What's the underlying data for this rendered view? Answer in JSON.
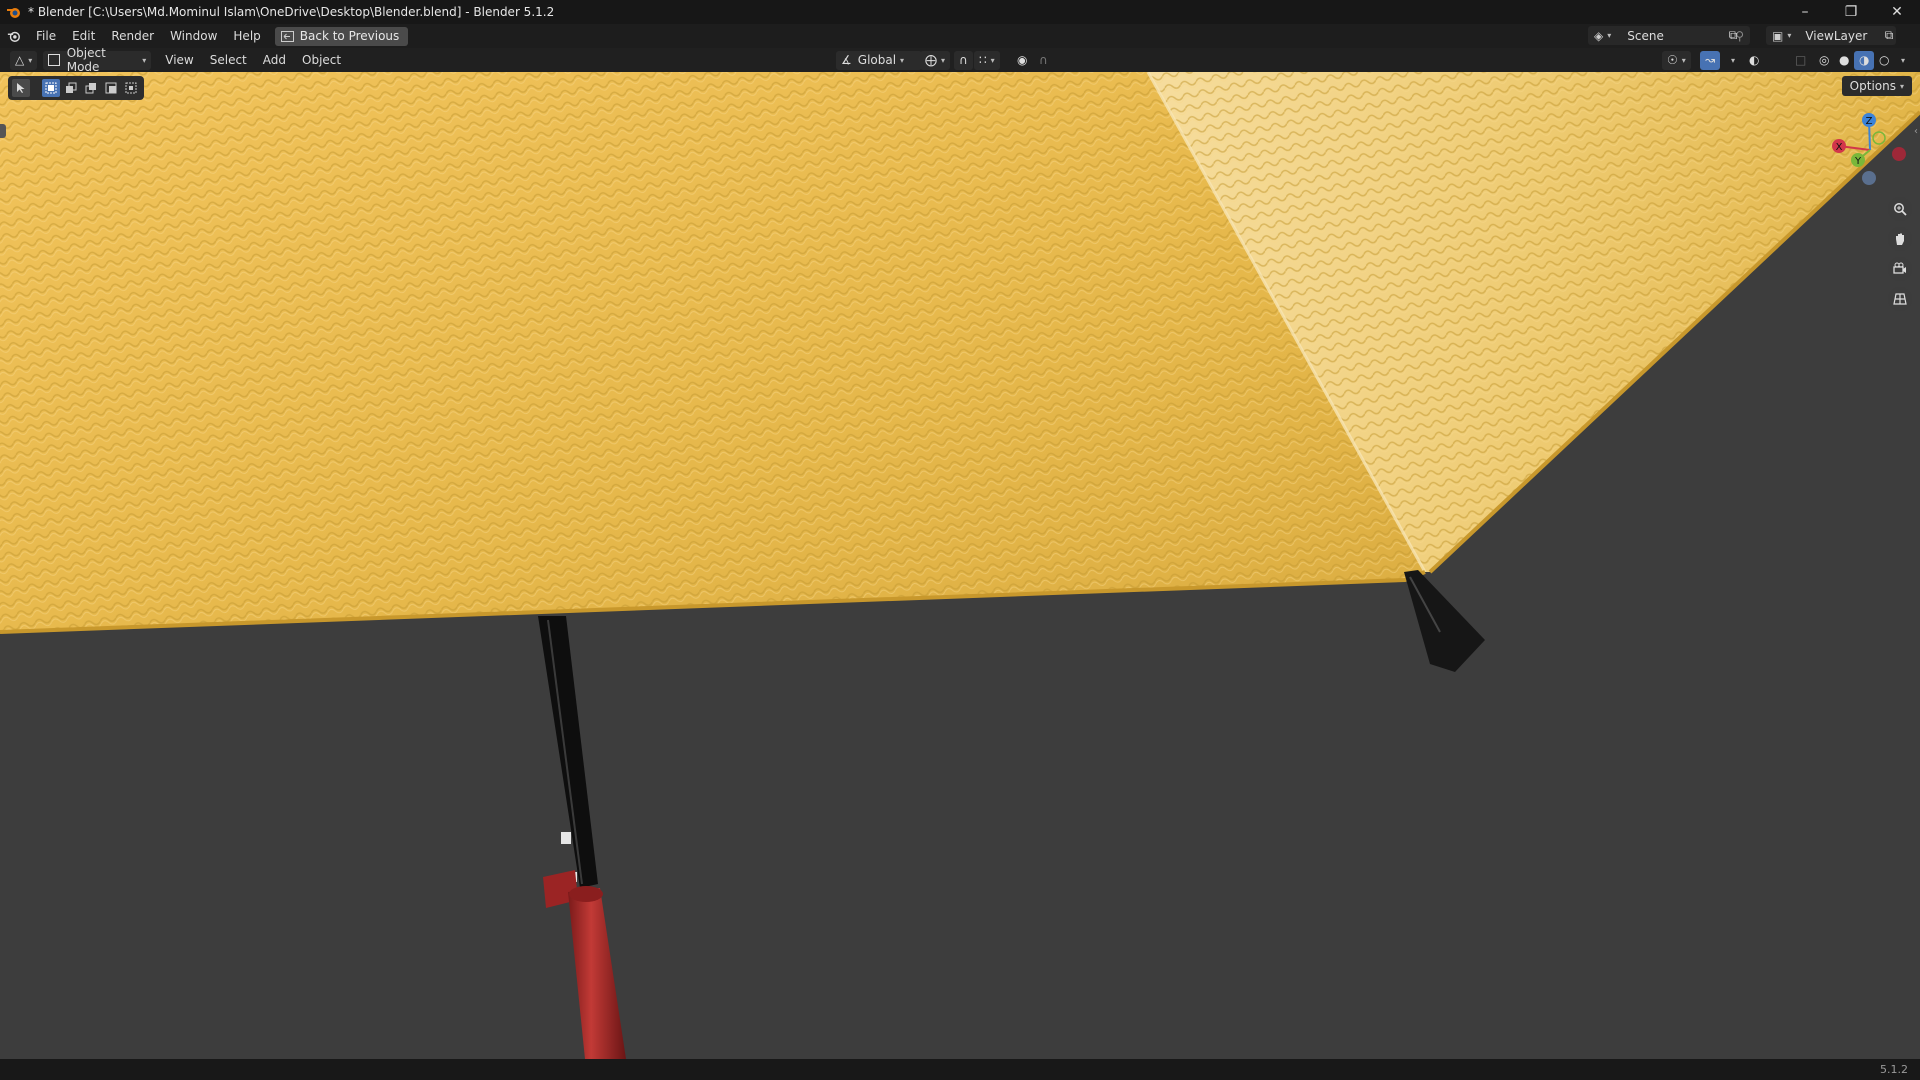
{
  "window": {
    "title": "* Blender [C:\\Users\\Md.Mominul Islam\\OneDrive\\Desktop\\Blender.blend] - Blender 5.1.2"
  },
  "menubar": {
    "items": [
      "File",
      "Edit",
      "Render",
      "Window",
      "Help"
    ],
    "back_label": "Back to Previous",
    "scene_label": "Scene",
    "viewlayer_label": "ViewLayer"
  },
  "header": {
    "mode_label": "Object Mode",
    "menu_items": [
      "View",
      "Select",
      "Add",
      "Object"
    ],
    "orientation_label": "Global"
  },
  "viewport": {
    "options_label": "Options",
    "gizmo_axes": [
      "X",
      "Y",
      "Z"
    ]
  },
  "statusbar": {
    "version": "5.1.2"
  },
  "colors": {
    "canopy": "#e8b845",
    "x_axis": "#d2364a",
    "y_axis": "#7ab73a",
    "z_axis": "#3b83d8",
    "handle": "#b02a2a"
  }
}
